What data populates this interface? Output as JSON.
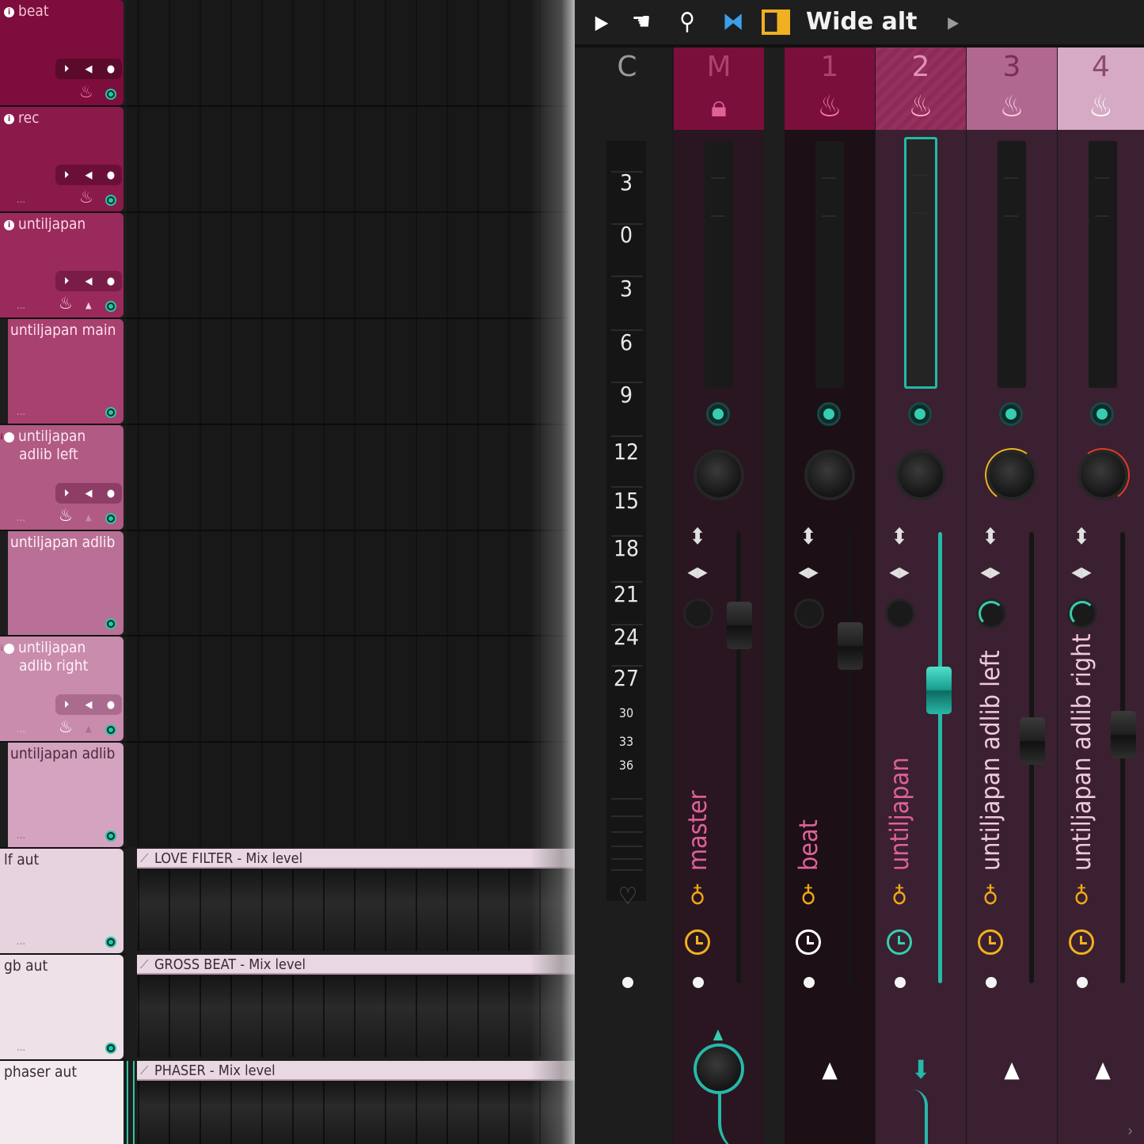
{
  "playlist": {
    "tracks": [
      {
        "name": "beat",
        "kind": "audio",
        "color": "#7d0d3c",
        "has_info": true
      },
      {
        "name": "rec",
        "kind": "audio",
        "color": "#8a1a4a",
        "has_info": true
      },
      {
        "name": "untiljapan",
        "kind": "audio",
        "color": "#9a2a5c",
        "has_info": true
      },
      {
        "name": "untiljapan main",
        "kind": "sub",
        "color": "#a84070"
      },
      {
        "name": "untiljapan adlib left",
        "kind": "audio",
        "color": "#b05a84",
        "has_info": true
      },
      {
        "name": "untiljapan adlib",
        "kind": "sub",
        "color": "#ba7096"
      },
      {
        "name": "untiljapan adlib right",
        "kind": "audio",
        "color": "#c98cad",
        "has_info": true
      },
      {
        "name": "untiljapan adlib",
        "kind": "sub",
        "color": "#d4a3c0"
      },
      {
        "name": "lf aut",
        "kind": "auto",
        "color": "#e6d3de"
      },
      {
        "name": "gb aut",
        "kind": "auto",
        "color": "#eee1e8"
      },
      {
        "name": "phaser aut",
        "kind": "auto",
        "color": "#f3eaef"
      }
    ],
    "clips": [
      {
        "label": "LOVE FILTER - Mix level"
      },
      {
        "label": "GROSS BEAT - Mix level"
      },
      {
        "label": "PHASER - Mix level"
      }
    ],
    "ellipsis": "..."
  },
  "mixer": {
    "toolbar": {
      "preset_name": "Wide alt",
      "icons": [
        "play-arrow-icon",
        "hand-tool-icon",
        "pin-icon",
        "wide-stereo-icon",
        "panel-toggle-icon",
        "next-arrow-icon"
      ]
    },
    "scale": {
      "header": "C",
      "labels": [
        "3",
        "0",
        "3",
        "6",
        "9",
        "12",
        "15",
        "18",
        "21",
        "24",
        "27",
        "30",
        "33",
        "36"
      ]
    },
    "strips": [
      {
        "number": "M",
        "name": "master",
        "icon": "lock-icon",
        "head_color": "#7a0f3c",
        "name_color": "#e0609a",
        "clock_color": "#f0b020",
        "route": "up-arrow-ring"
      },
      {
        "number": "1",
        "name": "beat",
        "icon": "flame-icon",
        "head_color": "#7a0f3c",
        "name_color": "#e0609a",
        "clock_color": "#ffffff",
        "route": "up-arrow"
      },
      {
        "number": "2",
        "name": "untiljapan",
        "icon": "flame-icon",
        "head_color": "#96305f",
        "name_color": "#e0609a",
        "clock_color": "#36cdb1",
        "route": "down-arrow",
        "selected": true
      },
      {
        "number": "3",
        "name": "untiljapan adlib left",
        "icon": "flame-icon",
        "head_color": "#b06890",
        "name_color": "#f0c8dc",
        "clock_color": "#f0b020",
        "route": "up-arrow",
        "pan_knob": "yellow"
      },
      {
        "number": "4",
        "name": "untiljapan adlib right",
        "icon": "flame-icon",
        "head_color": "#d6aac4",
        "name_color": "#f0c8dc",
        "clock_color": "#f0b020",
        "route": "up-arrow",
        "pan_knob": "red"
      }
    ]
  }
}
